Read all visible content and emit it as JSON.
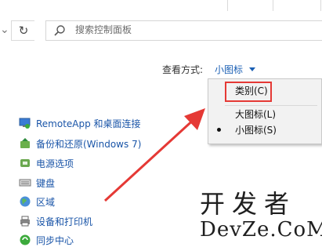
{
  "toolbar": {
    "search_placeholder": "搜索控制面板"
  },
  "view_selector": {
    "label": "查看方式:",
    "value": "小图标"
  },
  "view_menu": {
    "items": [
      {
        "label": "类别(C)"
      },
      {
        "label": "大图标(L)"
      },
      {
        "label": "小图标(S)"
      }
    ]
  },
  "control_panel": {
    "items": [
      {
        "label": "RemoteApp 和桌面连接",
        "icon": "remoteapp-icon"
      },
      {
        "label": "备份和还原(Windows 7)",
        "icon": "backup-icon"
      },
      {
        "label": "电源选项",
        "icon": "power-icon"
      },
      {
        "label": "键盘",
        "icon": "keyboard-icon"
      },
      {
        "label": "区域",
        "icon": "region-icon"
      },
      {
        "label": "设备和打印机",
        "icon": "printer-icon"
      },
      {
        "label": "同步中心",
        "icon": "sync-icon"
      }
    ]
  },
  "watermark": {
    "cn": "开发者",
    "en": "DevZe.CoM"
  },
  "colors": {
    "link": "#1a55a8",
    "highlight_box": "#e53935",
    "arrow": "#e53935"
  }
}
